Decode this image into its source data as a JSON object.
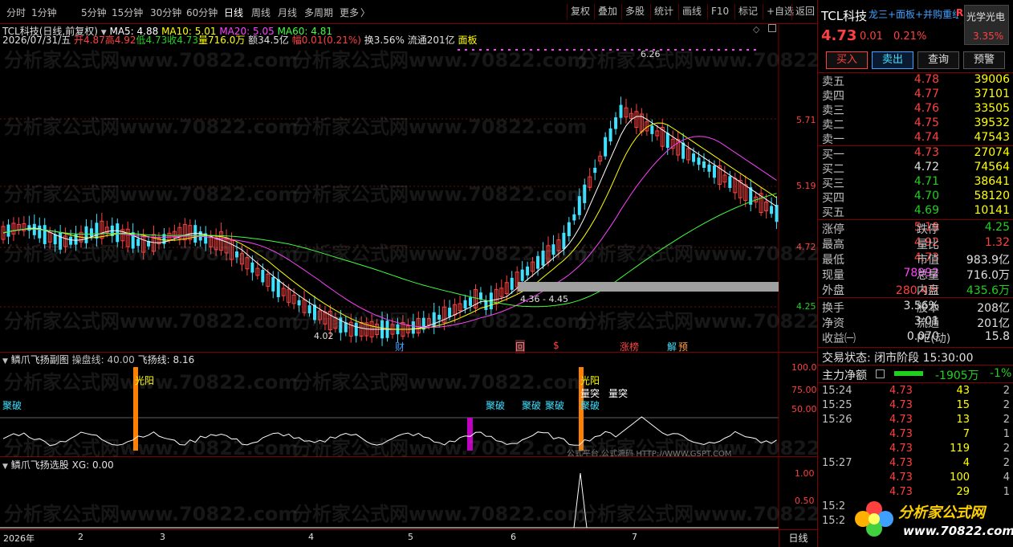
{
  "toolbar": {
    "periods": [
      "分时",
      "1分钟",
      "5分钟",
      "15分钟",
      "30分钟",
      "60分钟",
      "日线",
      "周线",
      "月线",
      "多周期",
      "更多"
    ],
    "more_arrow": "〉",
    "right": [
      "复权",
      "叠加",
      "多股",
      "统计",
      "画线",
      "F10",
      "标记",
      "+自选",
      "返回"
    ]
  },
  "main": {
    "stock_name": "TCL科技",
    "chart_mode": "(日线,前复权)",
    "ma": [
      {
        "label": "MA5: 4.88",
        "color": "#ffffff"
      },
      {
        "label": "MA10: 5.01",
        "color": "#ffff00"
      },
      {
        "label": "MA20: 5.05",
        "color": "#ff40ff"
      },
      {
        "label": "MA60: 4.81",
        "color": "#40ff40"
      }
    ],
    "info_date": "2026/07/31/五",
    "info_open": "开4.87",
    "info_high": "高4.92",
    "info_low": "低4.73",
    "info_close": "收4.73",
    "info_vol": "量716.0万",
    "info_amt": "额34.5亿",
    "info_chg": "幅0.01(0.21%)",
    "info_turn": "换3.56%",
    "info_float": "流通201亿",
    "info_concept": "面板",
    "price_ticks": [
      "5.71",
      "5.19",
      "4.72",
      "4.25"
    ],
    "high_label": "6.26",
    "low_label": "4.02",
    "mid_label": "4.36 - 4.45",
    "events": [
      "财",
      "回",
      "$",
      "涨榜",
      "解",
      "预"
    ]
  },
  "ind1": {
    "title": "鳞爪飞扬副图",
    "param1": "操盘线: 40.00",
    "param2": "飞扬线: 8.16",
    "ticks": [
      "100.0",
      "75.00",
      "50.00"
    ],
    "sig_guangyang": "光阳",
    "sig_jupo": "聚破",
    "sig_liangtu": "量突",
    "watermark_src": "公式平台,公式源码 HTTP://WWW.GSPT.COM"
  },
  "ind2": {
    "title": "鳞爪飞扬选股",
    "param": "XG: 0.00",
    "ticks": [
      "1.00",
      "0.50"
    ]
  },
  "datebar": {
    "labels": [
      "2026年",
      "2",
      "3",
      "4",
      "5",
      "6",
      "7"
    ],
    "period": "日线"
  },
  "watermark": "分析家公式网www.70822.com",
  "right": {
    "name": "TCL科技",
    "tag": "龙三+面板+并购重组",
    "flag": "R",
    "sector_name": "光学光电",
    "sector_pct": "3.35%",
    "price": "4.73",
    "change": "0.01",
    "pct": "0.21%",
    "buttons": [
      "买入",
      "卖出",
      "查询",
      "预警"
    ],
    "asks": [
      {
        "l": "卖五",
        "p": "4.78",
        "v": "39006"
      },
      {
        "l": "卖四",
        "p": "4.77",
        "v": "37101"
      },
      {
        "l": "卖三",
        "p": "4.76",
        "v": "33505"
      },
      {
        "l": "卖二",
        "p": "4.75",
        "v": "39532"
      },
      {
        "l": "卖一",
        "p": "4.74",
        "v": "47543"
      }
    ],
    "bids": [
      {
        "l": "买一",
        "p": "4.73",
        "v": "27074",
        "c": "red"
      },
      {
        "l": "买二",
        "p": "4.72",
        "v": "74564",
        "c": "white"
      },
      {
        "l": "买三",
        "p": "4.71",
        "v": "38641",
        "c": "green"
      },
      {
        "l": "买四",
        "p": "4.70",
        "v": "58120",
        "c": "green"
      },
      {
        "l": "买五",
        "p": "4.69",
        "v": "10141",
        "c": "green"
      }
    ],
    "stats": [
      {
        "a": "涨停",
        "av": "5.19",
        "ac": "red",
        "b": "跌停",
        "bv": "4.25",
        "bc": "green"
      },
      {
        "a": "最高",
        "av": "4.92",
        "ac": "red",
        "b": "量比",
        "bv": "1.32",
        "bc": "red"
      },
      {
        "a": "最低",
        "av": "4.73",
        "ac": "red",
        "b": "市值",
        "bv": "983.9亿",
        "bc": "white"
      },
      {
        "a": "现量",
        "av": "78992",
        "ac": "purple",
        "b": "总量",
        "bv": "716.0万",
        "bc": "white"
      },
      {
        "a": "外盘",
        "av": "280.4万",
        "ac": "red",
        "b": "内盘",
        "bv": "435.6万",
        "bc": "green"
      }
    ],
    "stats2": [
      {
        "a": "换手",
        "av": "3.56%",
        "ac": "white",
        "b": "股本",
        "bv": "208亿",
        "bc": "white"
      },
      {
        "a": "净资",
        "av": "3.01",
        "ac": "white",
        "b": "流通",
        "bv": "201亿",
        "bc": "white"
      },
      {
        "a": "收益㈠",
        "av": "0.070",
        "ac": "white",
        "b": "PE(动)",
        "bv": "15.8",
        "bc": "white"
      }
    ],
    "trade_state": "交易状态: 闭市阶段 15:30:00",
    "main_net_label": "主力净额",
    "main_net_value": "-1905万",
    "main_net_pct": "-1%",
    "ticks": [
      {
        "t": "15:24",
        "p": "4.73",
        "v": "43",
        "n": "2"
      },
      {
        "t": "15:25",
        "p": "4.73",
        "v": "15",
        "n": "2"
      },
      {
        "t": "15:26",
        "p": "4.73",
        "v": "13",
        "n": "2"
      },
      {
        "t": "",
        "p": "4.73",
        "v": "7",
        "n": "1"
      },
      {
        "t": "",
        "p": "4.73",
        "v": "119",
        "n": "2"
      },
      {
        "t": "15:27",
        "p": "4.73",
        "v": "4",
        "n": "2"
      },
      {
        "t": "",
        "p": "4.73",
        "v": "100",
        "n": "4"
      },
      {
        "t": "",
        "p": "4.73",
        "v": "29",
        "n": "1"
      },
      {
        "t": "15:2",
        "p": "",
        "v": "",
        "n": ""
      },
      {
        "t": "15:2",
        "p": "",
        "v": "",
        "n": ""
      }
    ],
    "logo_text": "分析家公式网",
    "logo_url": "www.70822.com"
  },
  "colors": {
    "up": "#ff4040",
    "down": "#40e0ff",
    "ma5": "#ffffff",
    "ma10": "#ffff00",
    "ma20": "#ff40ff",
    "ma60": "#40ff40"
  }
}
